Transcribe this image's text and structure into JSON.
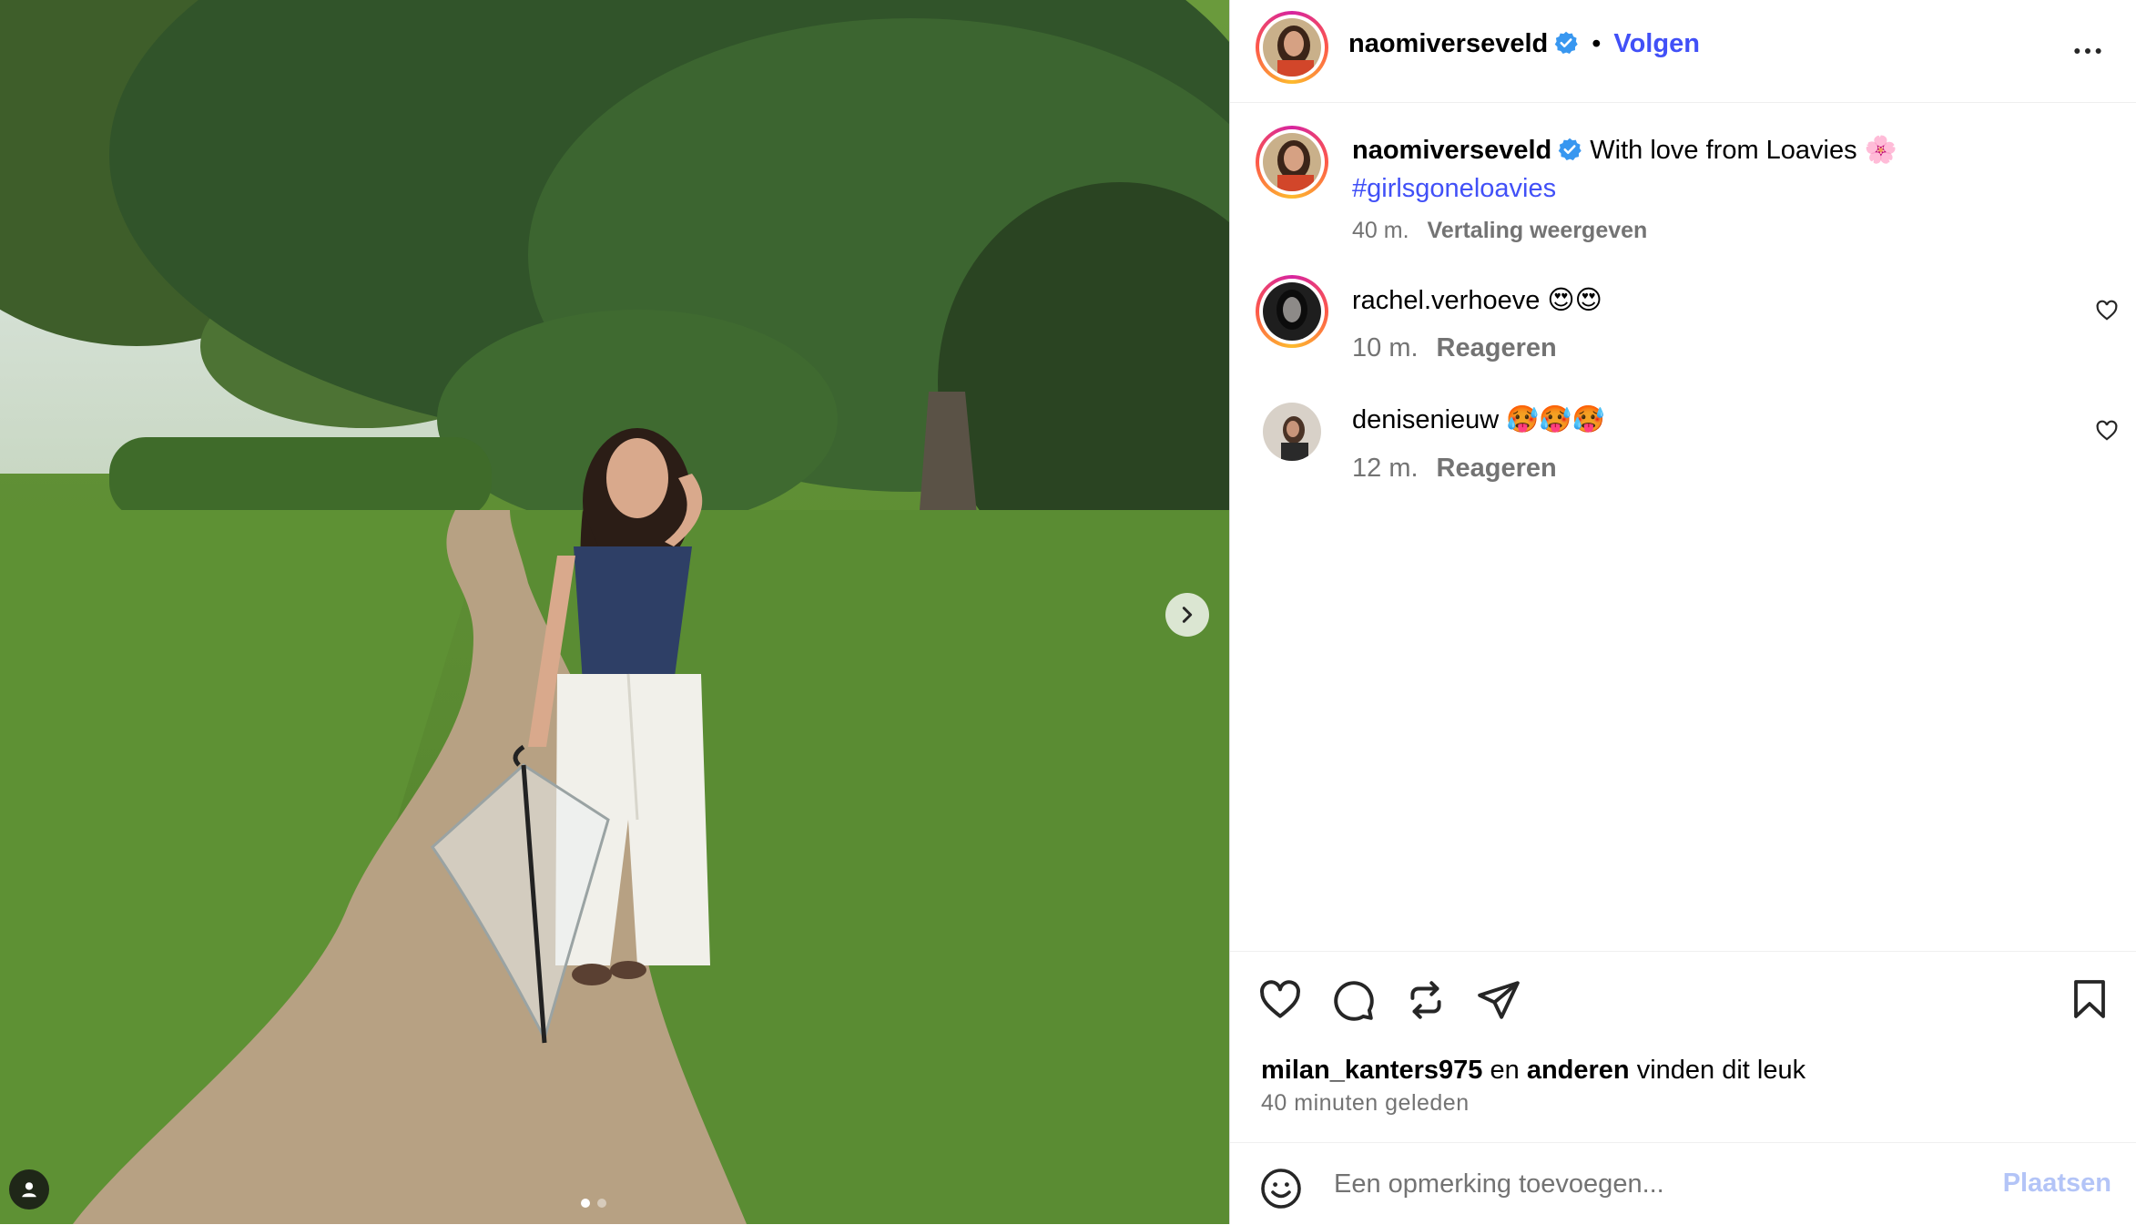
{
  "post": {
    "author": "naomiverseveld",
    "follow_label": "Volgen",
    "separator": "•",
    "caption": "With love from Loavies 🌸",
    "hashtag": "#girlsgoneloavies",
    "time": "40 m.",
    "translate_label": "Vertaling weergeven",
    "carousel": {
      "count": 2,
      "active": 0
    }
  },
  "comments": [
    {
      "username": "rachel.verhoeve",
      "text": "😍😍",
      "time": "10 m.",
      "reply_label": "Reageren"
    },
    {
      "username": "denisenieuw",
      "text": "🥵🥵🥵",
      "time": "12 m.",
      "reply_label": "Reageren"
    }
  ],
  "likes": {
    "first_user": "milan_kanters975",
    "connector": "en",
    "others_label": "anderen",
    "suffix": "vinden dit leuk",
    "ago": "40 minuten geleden"
  },
  "composer": {
    "placeholder": "Een opmerking toevoegen...",
    "post_label": "Plaatsen"
  },
  "colors": {
    "accent": "#4150f7",
    "verified": "#3897f0",
    "muted": "#737373",
    "post_disabled": "#b3c4f7"
  },
  "icons": [
    "verified-badge-icon",
    "more-options-icon",
    "heart-icon",
    "comment-icon",
    "repost-icon",
    "share-icon",
    "bookmark-icon",
    "emoji-icon",
    "chevron-right-icon",
    "user-tag-icon"
  ]
}
